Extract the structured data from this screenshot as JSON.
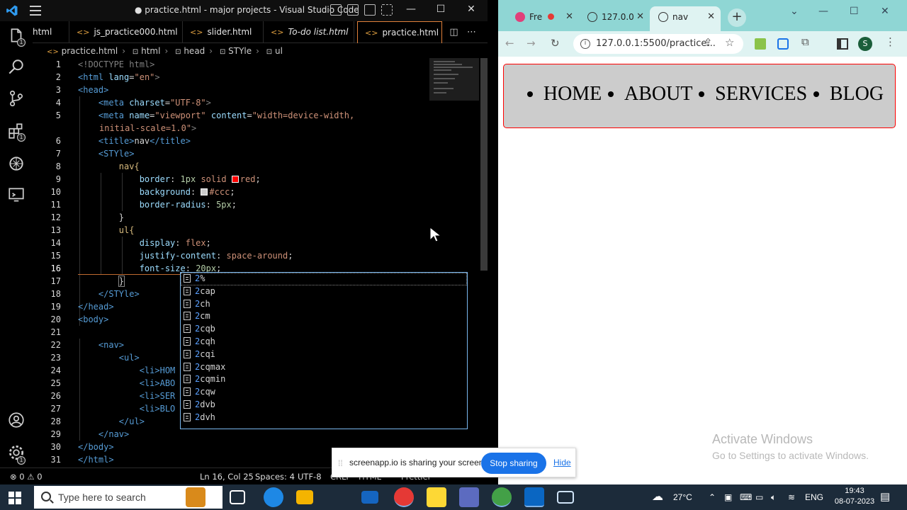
{
  "vscode": {
    "title": "● practice.html - major projects - Visual Studio Code",
    "tabs": [
      {
        "label": "html"
      },
      {
        "label": "js_practice000.html"
      },
      {
        "label": "slider.html"
      },
      {
        "label": "To-do list.html"
      },
      {
        "label": "practice.html"
      }
    ],
    "breadcrumb": [
      "practice.html",
      "html",
      "head",
      "STYle",
      "ul"
    ],
    "lines": [
      {
        "n": "1"
      },
      {
        "n": "2"
      },
      {
        "n": "3"
      },
      {
        "n": "4"
      },
      {
        "n": "5"
      },
      {
        "n": ""
      },
      {
        "n": "6"
      },
      {
        "n": "7"
      },
      {
        "n": "8"
      },
      {
        "n": "9"
      },
      {
        "n": "10"
      },
      {
        "n": "11"
      },
      {
        "n": "12"
      },
      {
        "n": "13"
      },
      {
        "n": "14"
      },
      {
        "n": "15"
      },
      {
        "n": "16"
      },
      {
        "n": "17"
      },
      {
        "n": "18"
      },
      {
        "n": "19"
      },
      {
        "n": "20"
      },
      {
        "n": "21"
      },
      {
        "n": "22"
      },
      {
        "n": "23"
      },
      {
        "n": "24"
      },
      {
        "n": "25"
      },
      {
        "n": "26"
      },
      {
        "n": "27"
      },
      {
        "n": "28"
      },
      {
        "n": "29"
      },
      {
        "n": "30"
      },
      {
        "n": "31"
      }
    ],
    "code": {
      "doctype": "<!DOCTYPE html>",
      "html_open_a": "<html ",
      "html_lang_attr": "lang",
      "html_lang_val": "\"en\"",
      "gt": ">",
      "head_open": "<head>",
      "meta1_tag": "<meta ",
      "meta1_attr": "charset",
      "meta1_val": "\"UTF-8\"",
      "meta2_tag": "<meta ",
      "meta2_attr1": "name",
      "meta2_val1": "\"viewport\"",
      "meta2_attr2": "content",
      "meta2_val2": "\"width=device-width,",
      "meta2_cont": "initial-scale=1.0\"",
      "title_open": "<title>",
      "title_text": "nav",
      "title_close": "</title>",
      "style_open": "<STYle>",
      "nav_sel": "nav{",
      "border_prop": "border",
      "border_val1": "1px",
      "border_val2": "solid",
      "border_val3": "red",
      "bg_prop": "background",
      "bg_val": "#ccc",
      "radius_prop": "border-radius",
      "radius_val": "5px",
      "close_brace": "}",
      "ul_sel": "ul{",
      "display_prop": "display",
      "display_val": "flex",
      "justify_prop": "justify-content",
      "justify_val": "space-around",
      "fs_prop": "font-size",
      "fs_val": "20px",
      "style_close": "</STYle>",
      "head_close": "</head>",
      "body_open": "<body>",
      "nav_open": "<nav>",
      "ul_open": "<ul>",
      "li1": "<li>HOM",
      "li2": "<li>ABO",
      "li3": "<li>SER",
      "li4": "<li>BLO",
      "ul_close": "</ul>",
      "nav_close": "</nav>",
      "body_close": "</body>",
      "html_close": "</html>"
    },
    "suggestions": [
      {
        "hl": "2",
        "rest": "%"
      },
      {
        "hl": "2",
        "rest": "cap"
      },
      {
        "hl": "2",
        "rest": "ch"
      },
      {
        "hl": "2",
        "rest": "cm"
      },
      {
        "hl": "2",
        "rest": "cqb"
      },
      {
        "hl": "2",
        "rest": "cqh"
      },
      {
        "hl": "2",
        "rest": "cqi"
      },
      {
        "hl": "2",
        "rest": "cqmax"
      },
      {
        "hl": "2",
        "rest": "cqmin"
      },
      {
        "hl": "2",
        "rest": "cqw"
      },
      {
        "hl": "2",
        "rest": "dvb"
      },
      {
        "hl": "2",
        "rest": "dvh"
      }
    ],
    "status": {
      "problems": "⊗ 0 ⚠ 0",
      "position": "Ln 16, Col 25",
      "spaces": "Spaces: 4",
      "encoding": "UTF-8",
      "eol": "CRLF",
      "lang": "HTML",
      "prettier": "Prettier"
    },
    "badges": {
      "explorer": "1",
      "extensions": "1"
    }
  },
  "browser": {
    "tabs": [
      {
        "label": "Fre"
      },
      {
        "label": "127.0.0"
      },
      {
        "label": "nav"
      }
    ],
    "url": "127.0.0.1:5500/practice...",
    "profile_initial": "S",
    "page": {
      "nav_items": [
        "HOME",
        "ABOUT",
        "SERVICES",
        "BLOG"
      ]
    },
    "watermark": {
      "line1": "Activate Windows",
      "line2": "Go to Settings to activate Windows."
    }
  },
  "sharebar": {
    "text": "screenapp.io is sharing your screen.",
    "stop_label": "Stop sharing",
    "hide_label": "Hide"
  },
  "taskbar": {
    "search_placeholder": "Type here to search",
    "weather": "27°C",
    "language": "ENG",
    "time": "19:43",
    "date": "08-07-2023"
  },
  "colors": {
    "accent_orange": "#e0803a",
    "vscode_blue": "#007acc",
    "browser_tab_bg": "#8fd6d4",
    "chrome_blue": "#1a73e8"
  }
}
